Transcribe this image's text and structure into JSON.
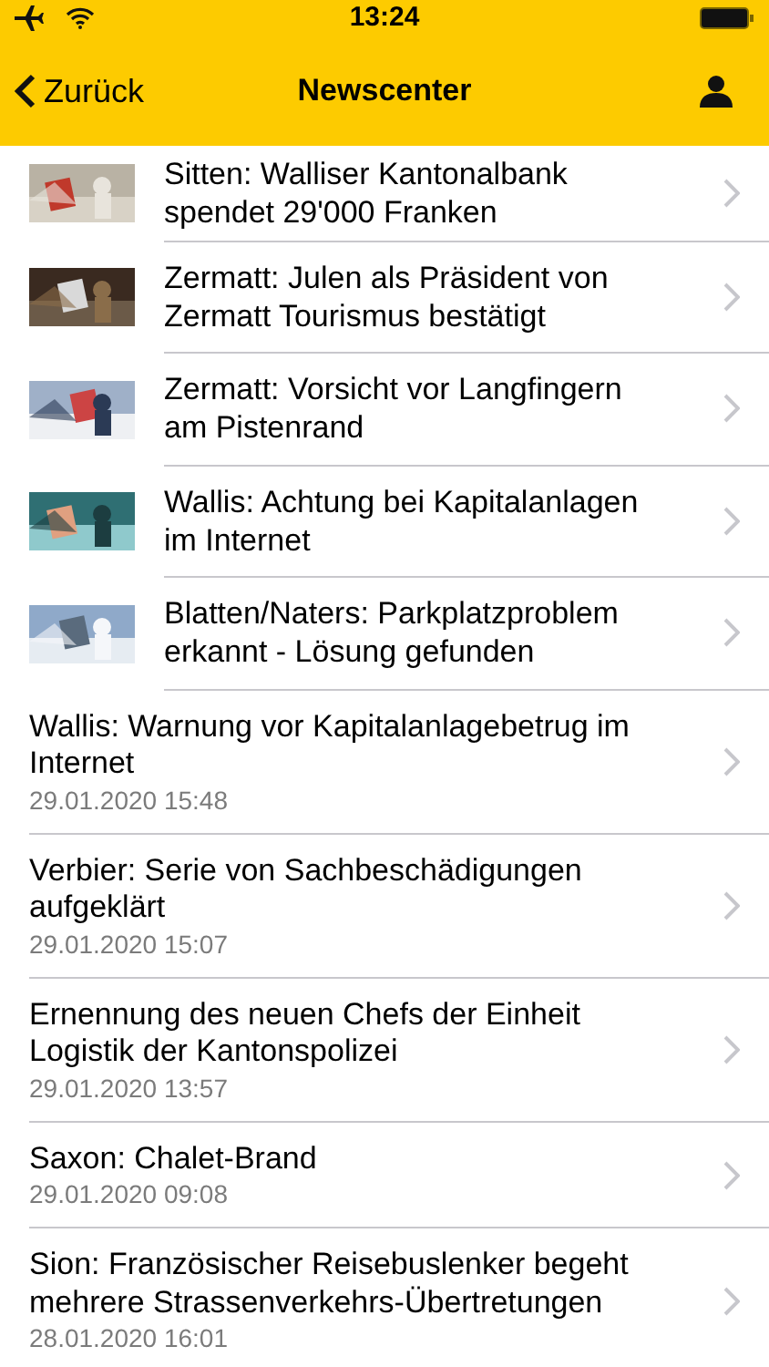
{
  "status_bar": {
    "time": "13:24"
  },
  "nav": {
    "back": "Zurück",
    "title": "Newscenter"
  },
  "items": [
    {
      "title": "Sitten: Walliser Kantonalbank spendet 29'000 Franken"
    },
    {
      "title": "Zermatt: Julen als Präsident von Zermatt Tourismus bestätigt"
    },
    {
      "title": "Zermatt: Vorsicht vor Langfingern am Pistenrand"
    },
    {
      "title": "Wallis: Achtung bei Kapitalanlagen im Internet"
    },
    {
      "title": "Blatten/Naters: Parkplatzproblem erkannt - Lösung gefunden"
    },
    {
      "kind": "dated",
      "title": "Wallis: Warnung vor Kapitalanlagebetrug im Internet",
      "date": "29.01.2020 15:48"
    },
    {
      "kind": "dated",
      "title": "Verbier: Serie von Sachbeschädigungen aufgeklärt",
      "date": "29.01.2020 15:07"
    },
    {
      "kind": "dated",
      "title": "Ernennung des neuen Chefs der Einheit Logistik der Kantonspolizei",
      "date": "29.01.2020 13:57"
    },
    {
      "kind": "dated",
      "title": "Saxon: Chalet-Brand",
      "date": "29.01.2020 09:08"
    },
    {
      "kind": "dated",
      "title": "Sion: Französischer Reisebuslenker begeht mehrere Strassenverkehrs-Übertretungen",
      "date": "28.01.2020 16:01"
    }
  ]
}
